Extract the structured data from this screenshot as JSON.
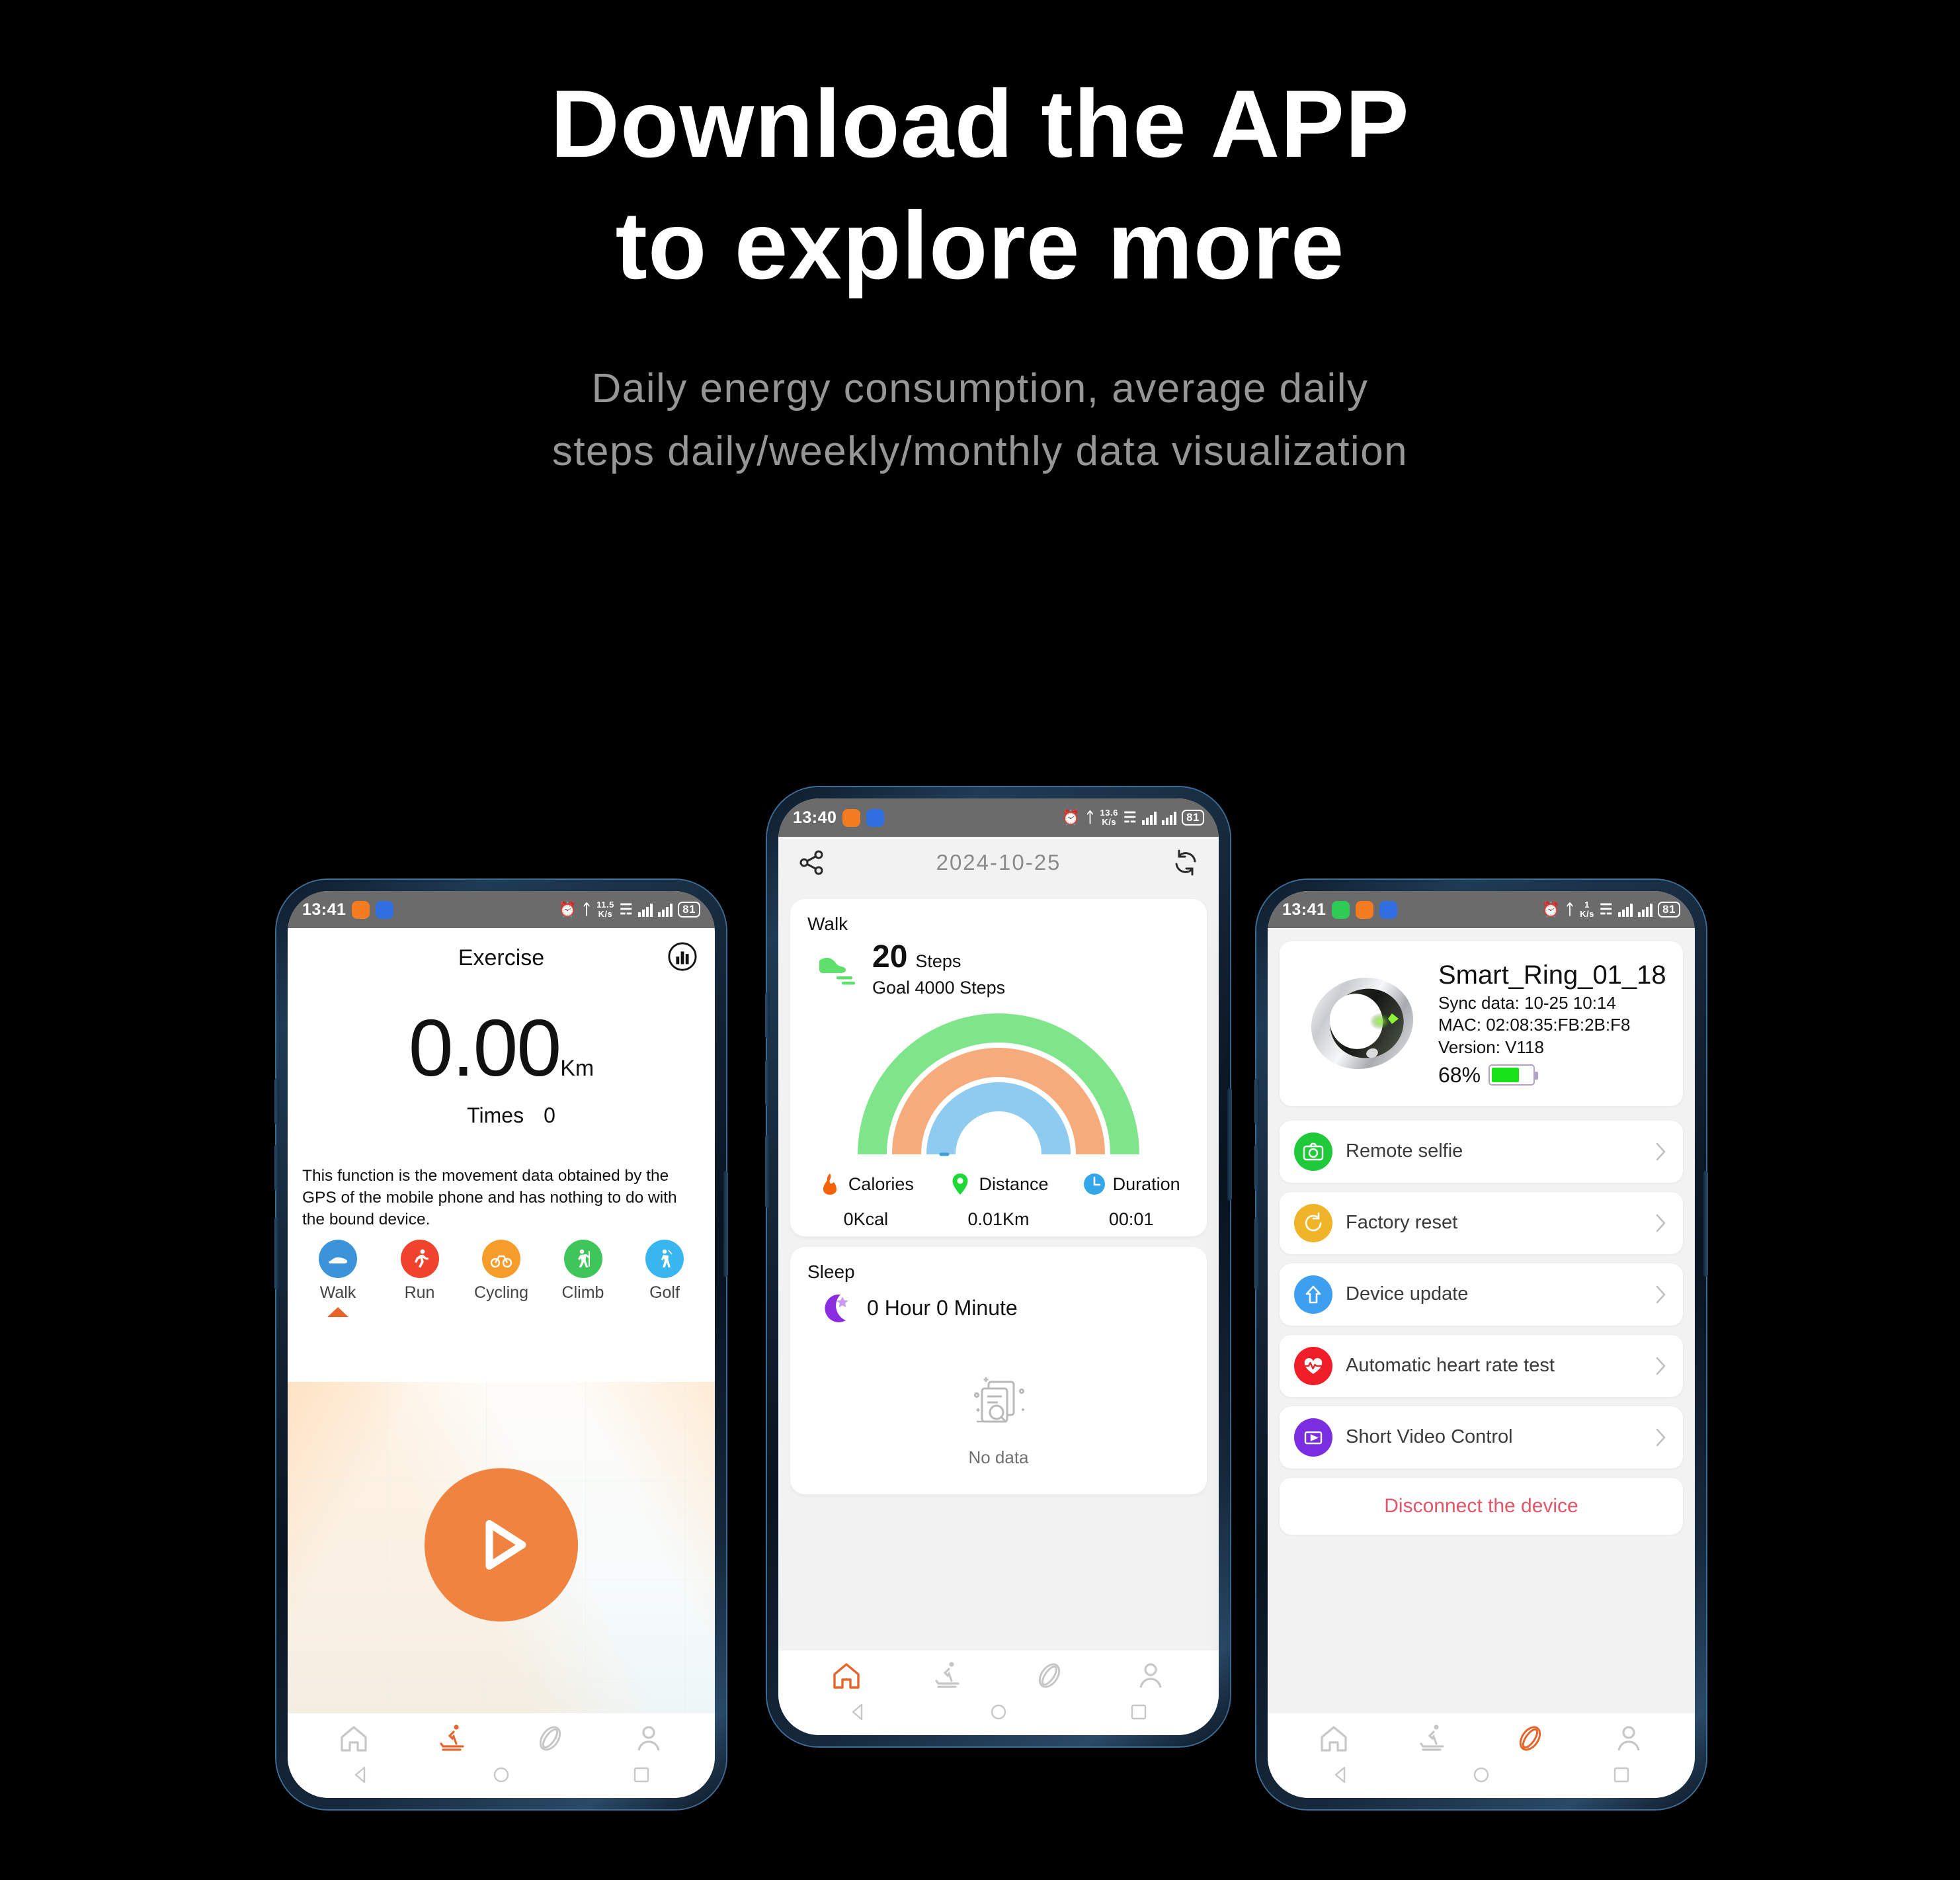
{
  "hero": {
    "title_line1": "Download the APP",
    "title_line2": "to explore more",
    "subtitle_line1": "Daily energy consumption, average daily",
    "subtitle_line2": "steps daily/weekly/monthly data visualization"
  },
  "colors": {
    "accent_orange": "#f08340",
    "tab_active_orange": "#e8642a",
    "gauge_green": "#7fe58a",
    "gauge_orange": "#f5ab7c",
    "gauge_blue": "#8fcbf0",
    "disconnect_red": "#e2566a",
    "status_bar_gray": "#6b6b6b",
    "screen_bg_gray": "#f2f2f2"
  },
  "phone_left": {
    "status_bar": {
      "time": "13:41",
      "badges": [
        "orange-app-badge",
        "blue-app-badge"
      ],
      "net_speed": "11.5",
      "net_speed_unit": "K/s",
      "battery": "81"
    },
    "appbar": {
      "title": "Exercise",
      "right_icon": "bar-chart-icon"
    },
    "distance": {
      "value": "0.00",
      "unit": "Km"
    },
    "times": {
      "label": "Times",
      "value": "0"
    },
    "note": "This function is the movement data obtained by the GPS of the mobile phone and has nothing to do with the bound device.",
    "activities": [
      {
        "label": "Walk",
        "icon": "shoe-icon",
        "color": "#3b93d9",
        "selected": true
      },
      {
        "label": "Run",
        "icon": "runner-icon",
        "color": "#f0432e",
        "selected": false
      },
      {
        "label": "Cycling",
        "icon": "bicycle-icon",
        "color": "#f59c2b",
        "selected": false
      },
      {
        "label": "Climb",
        "icon": "hiker-icon",
        "color": "#3ec65a",
        "selected": false
      },
      {
        "label": "Golf",
        "icon": "golfer-icon",
        "color": "#39b6ef",
        "selected": false
      }
    ],
    "start_button": "play-icon",
    "tabs": [
      {
        "name": "home",
        "icon": "home-icon",
        "active": false
      },
      {
        "name": "exercise",
        "icon": "treadmill-icon",
        "active": true
      },
      {
        "name": "device",
        "icon": "ring-icon",
        "active": false
      },
      {
        "name": "profile",
        "icon": "person-icon",
        "active": false
      }
    ]
  },
  "phone_center": {
    "status_bar": {
      "time": "13:40",
      "badges": [
        "orange-app-badge",
        "blue-app-badge"
      ],
      "net_speed": "13.6",
      "net_speed_unit": "K/s",
      "battery": "81"
    },
    "appbar": {
      "left_icon": "share-icon",
      "title": "2024-10-25",
      "right_icon": "refresh-icon"
    },
    "walk_card": {
      "label": "Walk",
      "icon": "shoe-icon",
      "steps_value": "20",
      "steps_unit": "Steps",
      "goal": "Goal 4000 Steps",
      "stats": [
        {
          "name": "Calories",
          "value": "0Kcal",
          "icon": "flame-icon",
          "color": "#f5620a"
        },
        {
          "name": "Distance",
          "value": "0.01Km",
          "icon": "pin-icon",
          "color": "#1ed838"
        },
        {
          "name": "Duration",
          "value": "00:01",
          "icon": "clock-icon",
          "color": "#34a7e8"
        }
      ]
    },
    "sleep_card": {
      "label": "Sleep",
      "icon": "moon-icon",
      "value": "0 Hour 0 Minute",
      "empty_text": "No data",
      "empty_icon": "no-data-icon"
    },
    "tabs": [
      {
        "name": "home",
        "icon": "home-icon",
        "active": true
      },
      {
        "name": "exercise",
        "icon": "treadmill-icon",
        "active": false
      },
      {
        "name": "device",
        "icon": "ring-icon",
        "active": false
      },
      {
        "name": "profile",
        "icon": "person-icon",
        "active": false
      }
    ]
  },
  "phone_right": {
    "status_bar": {
      "time": "13:41",
      "badges": [
        "green-app-badge",
        "orange-app-badge",
        "blue-app-badge"
      ],
      "net_speed": "1",
      "net_speed_unit": "K/s",
      "battery": "81"
    },
    "device": {
      "image": "smart-ring-image",
      "name": "Smart_Ring_01_18",
      "sync": "Sync data: 10-25 10:14",
      "mac": "MAC: 02:08:35:FB:2B:F8",
      "version": "Version: V118",
      "battery_pct": "68%",
      "battery_fill": 68
    },
    "menu": [
      {
        "label": "Remote selfie",
        "icon": "camera-icon",
        "color": "#1fc93a"
      },
      {
        "label": "Factory reset",
        "icon": "reset-icon",
        "color": "#f0b429"
      },
      {
        "label": "Device update",
        "icon": "upload-icon",
        "color": "#3d9ff0"
      },
      {
        "label": "Automatic heart rate test",
        "icon": "heartbeat-icon",
        "color": "#f01e28"
      },
      {
        "label": "Short Video Control",
        "icon": "video-icon",
        "color": "#7b2ee0"
      }
    ],
    "disconnect": "Disconnect the device",
    "tabs": [
      {
        "name": "home",
        "icon": "home-icon",
        "active": false
      },
      {
        "name": "exercise",
        "icon": "treadmill-icon",
        "active": false
      },
      {
        "name": "device",
        "icon": "ring-icon",
        "active": true
      },
      {
        "name": "profile",
        "icon": "person-icon",
        "active": false
      }
    ]
  },
  "chart_data": {
    "type": "gauge",
    "title": "Walk",
    "series": [
      {
        "name": "Steps",
        "value": 20,
        "max": 4000,
        "color": "#7fe58a",
        "unit": "Steps"
      },
      {
        "name": "Calories",
        "value": 0,
        "max": 300,
        "color": "#f5ab7c",
        "unit": "Kcal"
      },
      {
        "name": "Distance",
        "value": 0.01,
        "max": 3,
        "color": "#8fcbf0",
        "unit": "Km"
      }
    ],
    "annotations": [
      "20 Steps",
      "Goal 4000 Steps",
      "0Kcal",
      "0.01Km",
      "00:01"
    ],
    "legend": [
      "Calories",
      "Distance",
      "Duration"
    ],
    "legend_position": "bottom",
    "grid": false
  }
}
